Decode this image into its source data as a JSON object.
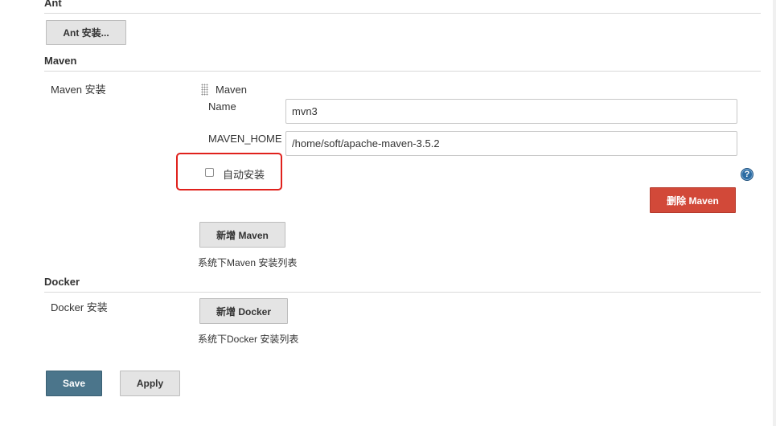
{
  "ant": {
    "title": "Ant",
    "install_button": "Ant 安装..."
  },
  "maven": {
    "title": "Maven",
    "row_label": "Maven 安装",
    "installer_title": "Maven",
    "name_label": "Name",
    "name_value": "mvn3",
    "home_label": "MAVEN_HOME",
    "home_value": "/home/soft/apache-maven-3.5.2",
    "auto_install_label": "自动安装",
    "auto_install_checked": false,
    "delete_button": "删除 Maven",
    "add_button": "新增 Maven",
    "hint": "系统下Maven 安装列表"
  },
  "docker": {
    "title": "Docker",
    "row_label": "Docker 安装",
    "add_button": "新增 Docker",
    "hint": "系统下Docker 安装列表"
  },
  "footer": {
    "save_label": "Save",
    "apply_label": "Apply"
  },
  "icons": {
    "help": "help-icon",
    "drag_handle": "drag-handle-icon"
  },
  "colors": {
    "primary_button": "#4b758b",
    "danger_button": "#d24939",
    "highlight_box": "#e0211c",
    "help_icon": "#2d6ca2"
  }
}
